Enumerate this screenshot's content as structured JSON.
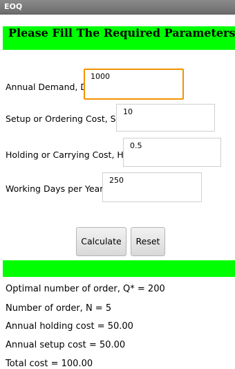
{
  "window": {
    "title": "EOQ"
  },
  "header": {
    "title": "Please Fill The Required Parameters"
  },
  "form": {
    "annual_demand": {
      "label": "Annual Demand, D",
      "value": "1000"
    },
    "setup_cost": {
      "label": "Setup or Ordering Cost, S",
      "value": "10"
    },
    "holding_cost": {
      "label": "Holding or Carrying Cost, H",
      "value": "0.5"
    },
    "working_days": {
      "label": "Working Days per Year",
      "value": "250"
    }
  },
  "buttons": {
    "calculate": "Calculate",
    "reset": "Reset"
  },
  "results": {
    "optimal_order": "Optimal number of order, Q* = 200",
    "num_orders": "Number of order, N = 5",
    "annual_holding": "Annual holding cost = 50.00",
    "annual_setup": "Annual setup cost = 50.00",
    "total_cost": "Total cost = 100.00"
  },
  "colors": {
    "accent_band": "#00ff00",
    "focus_border": "#f39200",
    "titlebar": "#7a7a7a"
  }
}
